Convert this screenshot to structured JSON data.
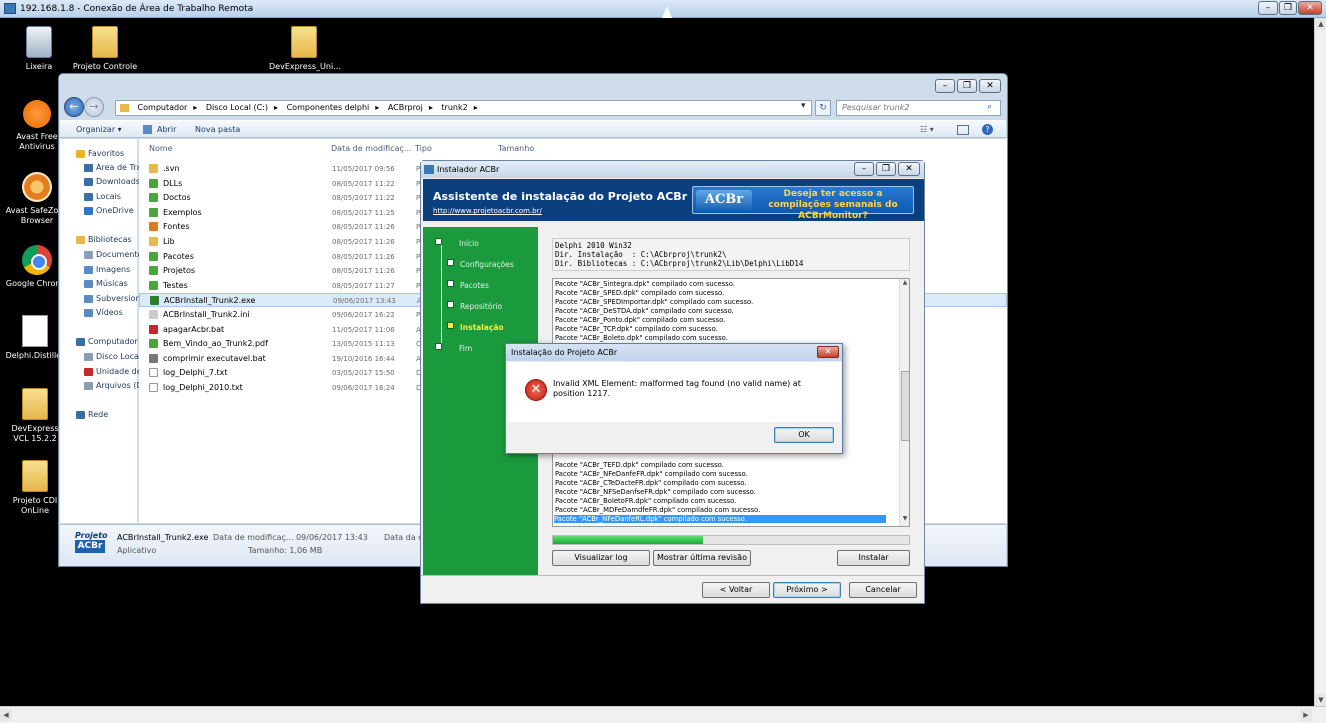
{
  "remote_desktop": {
    "title": "192.168.1.8 - Conexão de Área de Trabalho Remota"
  },
  "desktop_icons": [
    {
      "label": "Lixeira",
      "icon": "recycle-bin-icon"
    },
    {
      "label": "Projeto Controle",
      "icon": "folder-icon"
    },
    {
      "label": "DevExpress_Uni...",
      "icon": "folder-icon"
    },
    {
      "label": "Avast Free Antivirus",
      "icon": "avast-icon"
    },
    {
      "label": "Avast SafeZone Browser",
      "icon": "safezone-icon"
    },
    {
      "label": "Google Chrome",
      "icon": "chrome-icon"
    },
    {
      "label": "Delphi.Distiller",
      "icon": "document-icon"
    },
    {
      "label": "DevExpress VCL 15.2.2",
      "icon": "folder-icon"
    },
    {
      "label": "Projeto CDI OnLine",
      "icon": "folder-icon"
    }
  ],
  "explorer": {
    "breadcrumb": [
      "Computador",
      "Disco Local (C:)",
      "Componentes delphi",
      "ACBrproj",
      "trunk2"
    ],
    "search_placeholder": "Pesquisar trunk2",
    "toolbar": {
      "organize": "Organizar ▾",
      "open": "Abrir",
      "new_folder": "Nova pasta"
    },
    "nav": [
      {
        "label": "Favoritos",
        "icon": "star-icon",
        "color": "#e9b323"
      },
      {
        "label": "Área de Trabalho",
        "icon": "desktop-icon",
        "color": "#3a6ea5"
      },
      {
        "label": "Downloads",
        "icon": "downloads-icon",
        "color": "#3a6ea5"
      },
      {
        "label": "Locais",
        "icon": "places-icon",
        "color": "#3a6ea5"
      },
      {
        "label": "OneDrive",
        "icon": "cloud-icon",
        "color": "#2e76c7"
      },
      {
        "label": "Bibliotecas",
        "icon": "library-icon",
        "color": "#e7b84c"
      },
      {
        "label": "Documentos",
        "icon": "documents-icon",
        "color": "#8aa0b8"
      },
      {
        "label": "Imagens",
        "icon": "images-icon",
        "color": "#5a8bc4"
      },
      {
        "label": "Músicas",
        "icon": "music-icon",
        "color": "#5a8bc4"
      },
      {
        "label": "Subversion",
        "icon": "subversion-icon",
        "color": "#5a8bc4"
      },
      {
        "label": "Vídeos",
        "icon": "videos-icon",
        "color": "#5a8bc4"
      },
      {
        "label": "Computador",
        "icon": "computer-icon",
        "color": "#3a6ea5"
      },
      {
        "label": "Disco Local (C:)",
        "icon": "drive-icon",
        "color": "#8a9db3"
      },
      {
        "label": "Unidade de DVD",
        "icon": "dvd-icon",
        "color": "#c62828"
      },
      {
        "label": "Arquivos (D:)",
        "icon": "drive-icon",
        "color": "#8a9db3"
      },
      {
        "label": "Rede",
        "icon": "network-icon",
        "color": "#3a6ea5"
      }
    ],
    "columns": [
      "Nome",
      "Data de modificaç...",
      "Tipo",
      "Tamanho"
    ],
    "files": [
      {
        "name": ".svn",
        "date": "11/05/2017 09:56",
        "type": "P",
        "color": "#e7b84c"
      },
      {
        "name": "DLLs",
        "date": "08/05/2017 11:22",
        "type": "P",
        "color": "#4aa63c"
      },
      {
        "name": "Doctos",
        "date": "08/05/2017 11:22",
        "type": "P",
        "color": "#4aa63c"
      },
      {
        "name": "Exemplos",
        "date": "08/05/2017 11:25",
        "type": "P",
        "color": "#4aa63c"
      },
      {
        "name": "Fontes",
        "date": "08/05/2017 11:26",
        "type": "P",
        "color": "#e07a1f"
      },
      {
        "name": "Lib",
        "date": "08/05/2017 11:26",
        "type": "P",
        "color": "#e7b84c"
      },
      {
        "name": "Pacotes",
        "date": "08/05/2017 11:26",
        "type": "P",
        "color": "#4aa63c"
      },
      {
        "name": "Projetos",
        "date": "08/05/2017 11:26",
        "type": "P",
        "color": "#4aa63c"
      },
      {
        "name": "Testes",
        "date": "08/05/2017 11:27",
        "type": "P",
        "color": "#4aa63c"
      },
      {
        "name": "ACBrInstall_Trunk2.exe",
        "date": "09/06/2017 13:43",
        "type": "A",
        "color": "#2e7d32"
      },
      {
        "name": "ACBrInstall_Trunk2.ini",
        "date": "09/06/2017 16:22",
        "type": "P",
        "color": "#cccccc"
      },
      {
        "name": "apagarAcbr.bat",
        "date": "11/05/2017 11:06",
        "type": "A",
        "color": "#c62828"
      },
      {
        "name": "Bem_Vindo_ao_Trunk2.pdf",
        "date": "13/05/2015 11:13",
        "type": "C",
        "color": "#4aa63c"
      },
      {
        "name": "comprimir executavel.bat",
        "date": "19/10/2016 16:44",
        "type": "A",
        "color": "#777777"
      },
      {
        "name": "log_Delphi_7.txt",
        "date": "03/05/2017 15:50",
        "type": "D",
        "color": "#ffffff"
      },
      {
        "name": "log_Delphi_2010.txt",
        "date": "09/06/2017 16:24",
        "type": "D",
        "color": "#ffffff"
      }
    ],
    "details": {
      "logo_top": "Projeto",
      "logo_bottom": "ACBr",
      "name": "ACBrInstall_Trunk2.exe",
      "type": "Aplicativo",
      "modified": "Data de modificaç... 09/06/2017 13:43",
      "size": "Tamanho: 1,06 MB",
      "extra": "Data da cr"
    }
  },
  "installer": {
    "title": "Instalador ACBr",
    "heading": "Assistente de instalação do Projeto ACBr",
    "url": "http://www.projetoacbr.com.br/",
    "promo_logo": "ACBr",
    "promo": "Deseja ter acesso a compilações semanais do ACBrMonitor?",
    "steps": [
      {
        "label": "Início",
        "current": false
      },
      {
        "label": "Configurações",
        "current": false
      },
      {
        "label": "Pacotes",
        "current": false
      },
      {
        "label": "Repositório",
        "current": false
      },
      {
        "label": "Instalação",
        "current": true
      },
      {
        "label": "Fim",
        "current": false
      }
    ],
    "info": "Delphi 2010 Win32\nDir. Instalação  : C:\\ACbrproj\\trunk2\\\nDir. Bibliotecas : C:\\ACbrproj\\trunk2\\Lib\\Delphi\\LibD14",
    "log_top": [
      "Pacote \"ACBr_Sintegra.dpk\" compilado com sucesso.",
      "Pacote \"ACBr_SPED.dpk\" compilado com sucesso.",
      "Pacote \"ACBr_SPEDImportar.dpk\" compilado com sucesso.",
      "Pacote \"ACBr_DeSTDA.dpk\" compilado com sucesso.",
      "Pacote \"ACBr_Ponto.dpk\" compilado com sucesso.",
      "Pacote \"ACBr_TCP.dpk\" compilado com sucesso.",
      "Pacote \"ACBr_Boleto.dpk\" compilado com sucesso."
    ],
    "log_bottom": [
      "Pacote \"ACBr_TEFD.dpk\" compilado com sucesso.",
      "Pacote \"ACBr_NFeDanfeFR.dpk\" compilado com sucesso.",
      "Pacote \"ACBr_CTeDacteFR.dpk\" compilado com sucesso.",
      "Pacote \"ACBr_NFSeDanfseFR.dpk\" compilado com sucesso.",
      "Pacote \"ACBr_BoletoFR.dpk\" compilado com sucesso.",
      "Pacote \"ACBr_MDFeDamdfeFR.dpk\" compilado com sucesso.",
      "Pacote \"ACBr_NFeDanfeRL.dpk\" compilado com sucesso."
    ],
    "progress": 0.42,
    "buttons": {
      "view_log": "Visualizar log",
      "last_rev": "Mostrar última revisão",
      "install": "Instalar",
      "back": "< Voltar",
      "next": "Próximo >",
      "cancel": "Cancelar"
    }
  },
  "dialog": {
    "title": "Instalação do Projeto ACBr",
    "message": "Invalid XML Element: malformed tag found (no valid name) at position 1217.",
    "ok": "OK"
  }
}
